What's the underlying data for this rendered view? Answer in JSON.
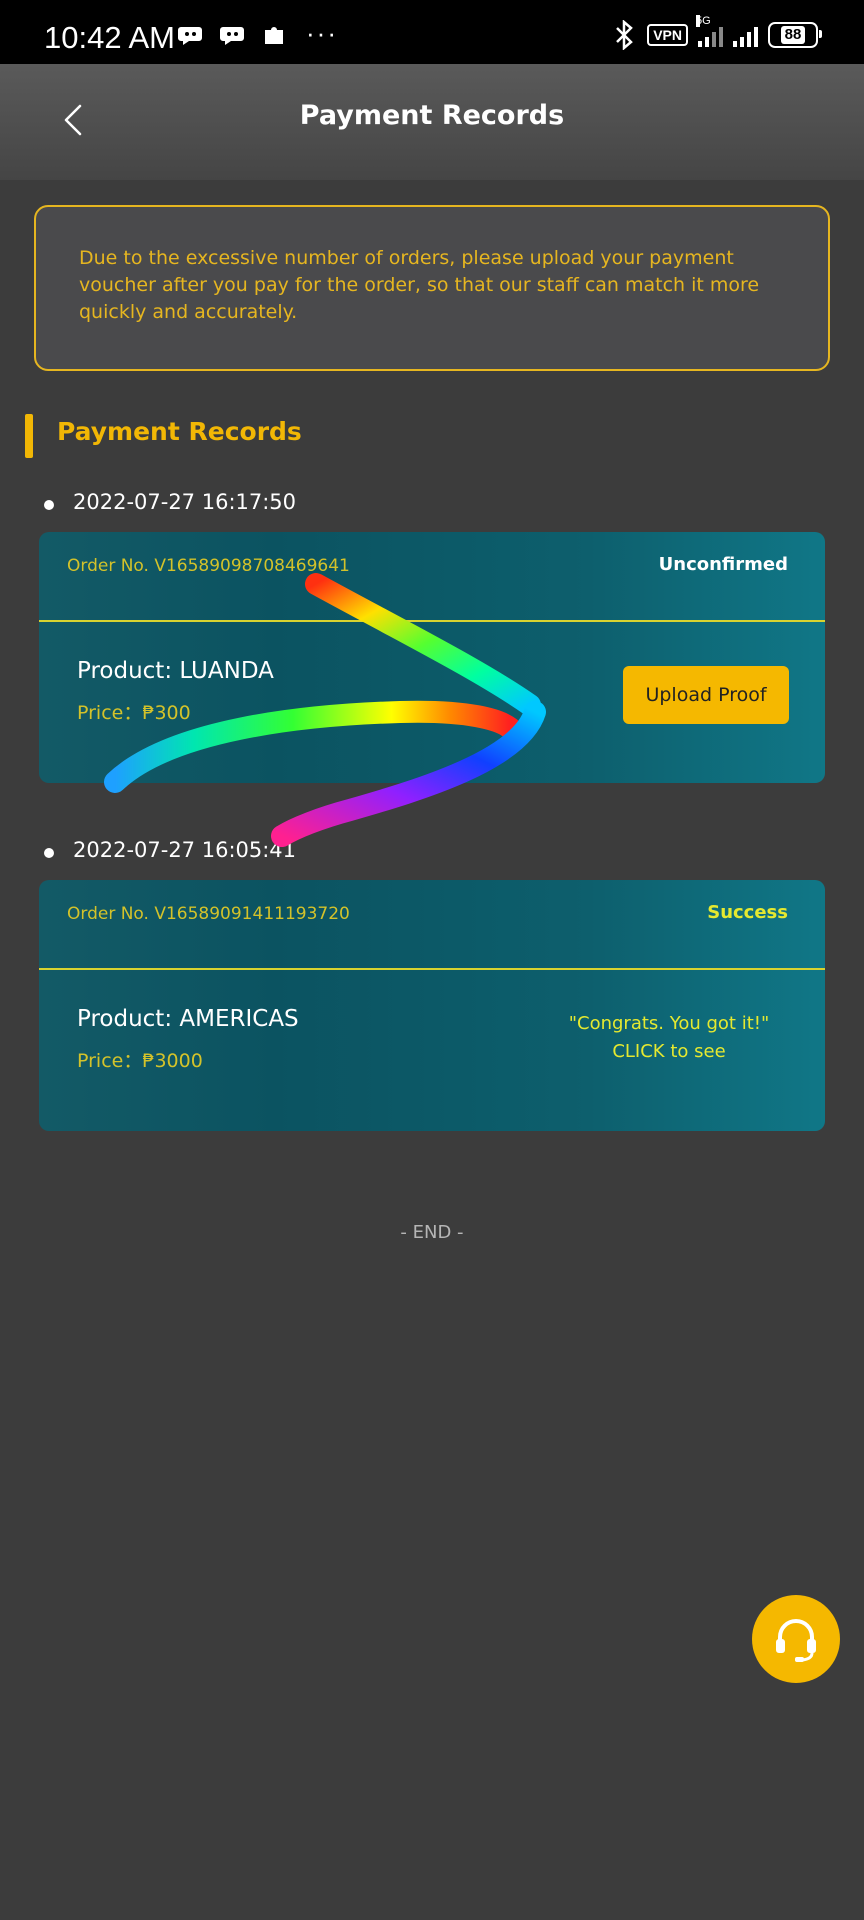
{
  "status_bar": {
    "time": "10:42 AM",
    "vpn_label": "VPN",
    "network_label": "5G",
    "battery": "88",
    "more_dots": "···",
    "icons": [
      "chat-bubble-icon",
      "chat-bubble-icon",
      "puzzle-icon",
      "bluetooth-icon",
      "signal-icon",
      "battery-icon"
    ]
  },
  "header": {
    "title": "Payment Records",
    "back_icon": "chevron-left-icon"
  },
  "notice": {
    "text": "Due to the excessive number of orders, please upload your payment voucher after you pay for the order, so that our staff can match it more quickly and accurately."
  },
  "section": {
    "title": "Payment Records"
  },
  "records": [
    {
      "datetime": "2022-07-27 16:17:50",
      "order_no": "Order No. V16589098708469641",
      "status": "Unconfirmed",
      "product": "Product: LUANDA",
      "price": "Price：₱300",
      "action_label": "Upload Proof"
    },
    {
      "datetime": "2022-07-27 16:05:41",
      "order_no": "Order No. V16589091411193720",
      "status": "Success",
      "product": "Product: AMERICAS",
      "price": "Price：₱3000",
      "result_line1": "\"Congrats. You got it!\"",
      "result_line2": "CLICK to see"
    }
  ],
  "footer": {
    "end_text": "- END -"
  },
  "support": {
    "icon": "headset-icon"
  },
  "colors": {
    "accent": "#f5b800",
    "background": "#3c3c3c",
    "card": "#0d5f6d",
    "status_text": "#e5e930"
  }
}
